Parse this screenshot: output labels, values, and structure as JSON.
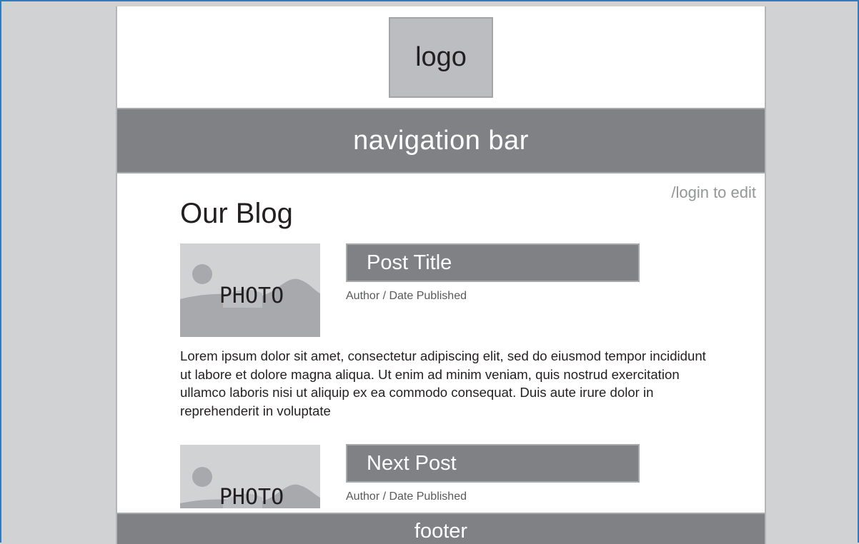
{
  "header": {
    "logo_label": "logo",
    "nav_label": "navigation bar"
  },
  "login_link": "/login to edit",
  "blog": {
    "title": "Our Blog",
    "posts": [
      {
        "photo_label": "PHOTO",
        "title": "Post Title",
        "meta": "Author / Date Published",
        "excerpt": "Lorem ipsum dolor sit amet, consectetur adipiscing elit, sed do eiusmod tempor incididunt ut labore et dolore magna aliqua. Ut enim ad minim veniam, quis nostrud exercitation ullamco laboris nisi ut aliquip ex ea commodo consequat. Duis aute irure dolor in reprehenderit in voluptate"
      },
      {
        "photo_label": "PHOTO",
        "title": "Next Post",
        "meta": "Author / Date Published"
      }
    ]
  },
  "footer": {
    "label": "footer"
  },
  "colors": {
    "outer_bg": "#d1d2d4",
    "frame_border": "#2f7ac0",
    "bar_gray": "#808185",
    "logo_box": "#bcbdc0",
    "link_gray": "#939598"
  }
}
